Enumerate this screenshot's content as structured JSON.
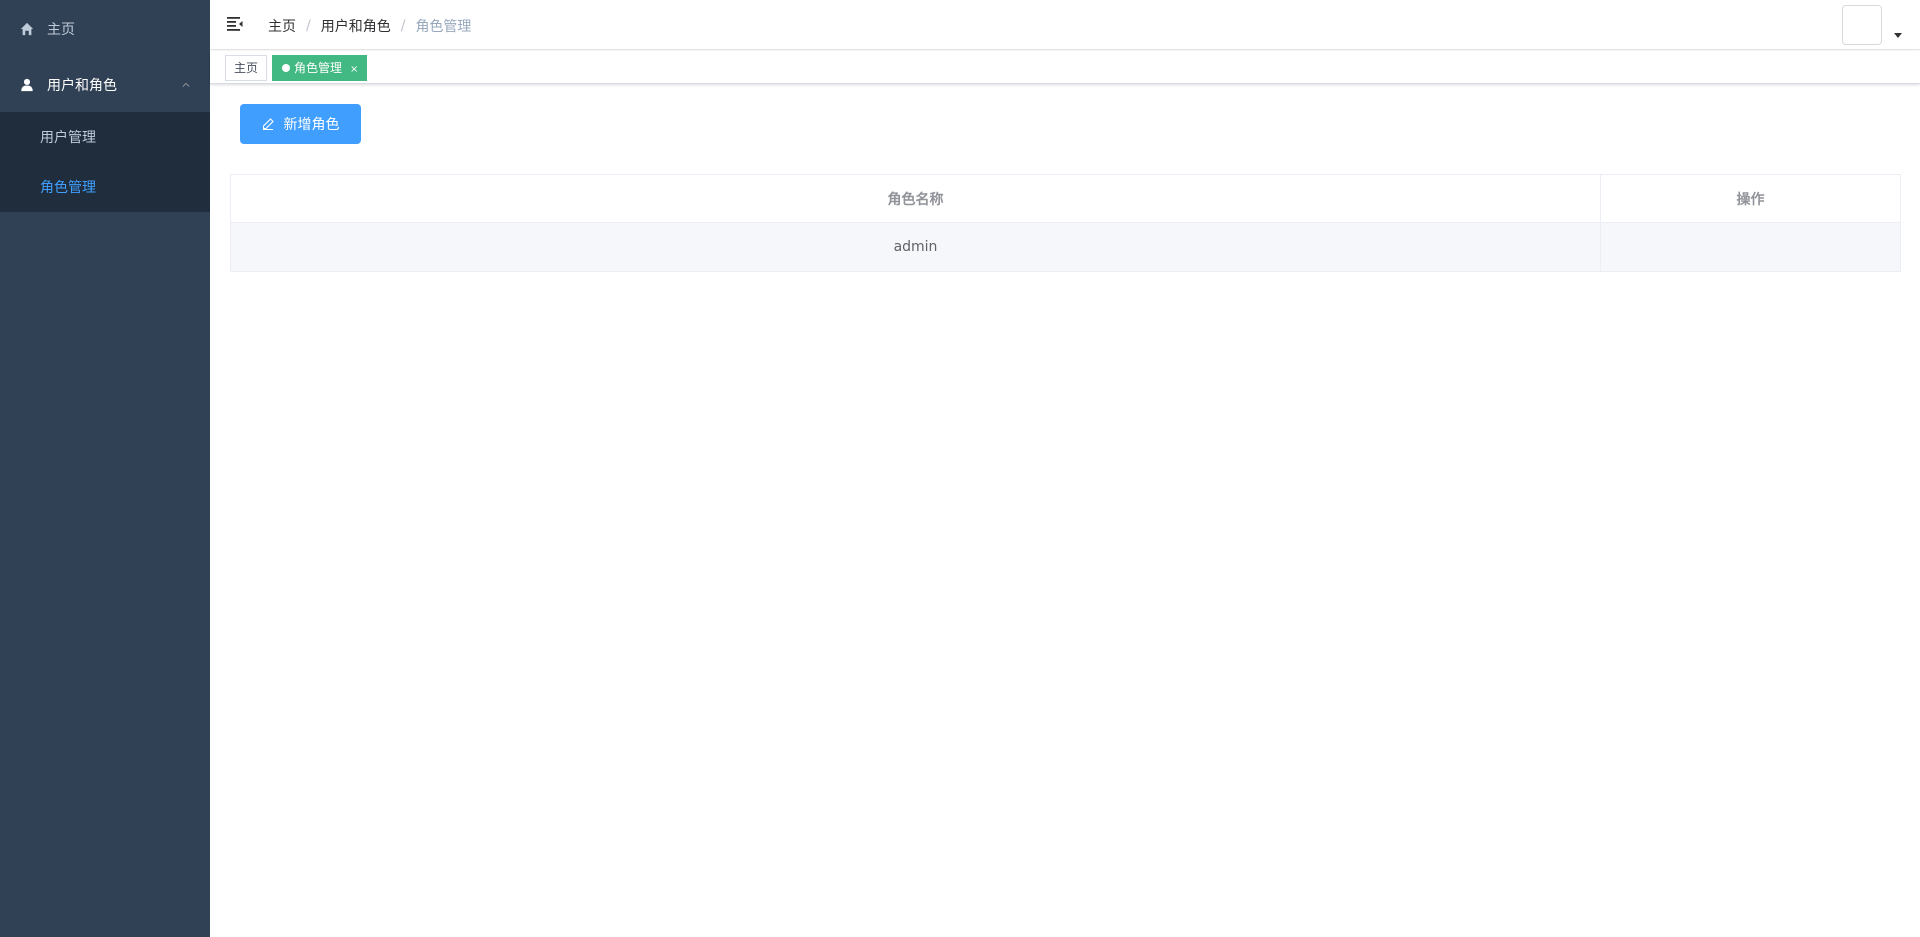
{
  "sidebar": {
    "home_label": "主页",
    "group_label": "用户和角色",
    "sub_items": [
      {
        "label": "用户管理"
      },
      {
        "label": "角色管理"
      }
    ],
    "active_color": "#409eff"
  },
  "navbar": {
    "breadcrumb": [
      "主页",
      "用户和角色",
      "角色管理"
    ],
    "breadcrumb_sep": "/"
  },
  "tags": {
    "home": "主页",
    "active": "角色管理",
    "close": "×",
    "active_color": "#42b983"
  },
  "main": {
    "add_button": "新增角色",
    "table": {
      "columns": [
        "角色名称",
        "操作"
      ],
      "rows": [
        {
          "name": "admin",
          "ops": ""
        }
      ]
    }
  },
  "icons": {
    "home": "home-icon",
    "user": "user-icon",
    "hamburger": "hamburger-icon",
    "edit": "edit-icon",
    "chevron": "chevron-up-icon",
    "caret": "caret-down-icon"
  }
}
